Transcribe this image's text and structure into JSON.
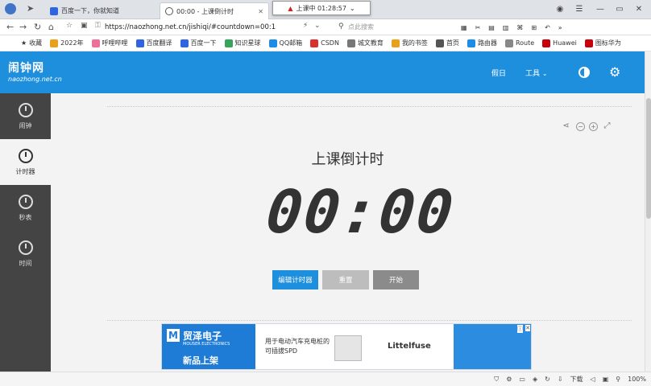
{
  "tabs": [
    {
      "label": "百度一下，你就知道"
    },
    {
      "label": "00:00 - 上课倒计时"
    }
  ],
  "clock_popup": {
    "text": "上课中 01:28:57"
  },
  "address": {
    "url": "https://naozhong.net.cn/jishiqi/#countdown=00:1",
    "search_placeholder": "点此搜索"
  },
  "toolbar_right": {
    "download": "下载",
    "zoom": "100%"
  },
  "bookmarks": [
    "收藏",
    "2022年",
    "呼哩哔哩",
    "百度翻译",
    "百度一下",
    "知识星球",
    "QQ邮箱",
    "CSDN",
    "城文教育",
    "我的书签",
    "首页",
    "路由器",
    "Route",
    "Huawei",
    "图标华为"
  ],
  "header": {
    "logo": "闹钟网",
    "domain": "naozhong.net.cn",
    "holiday": "假日",
    "tools": "工具"
  },
  "sidebar": [
    {
      "label": "闹钟"
    },
    {
      "label": "计时器"
    },
    {
      "label": "秒表"
    },
    {
      "label": "时间"
    }
  ],
  "timer": {
    "title": "上课倒计时",
    "time": "00:00"
  },
  "buttons": {
    "edit": "编辑计时器",
    "reset": "重置",
    "start": "开始"
  },
  "ad": {
    "brand": "贸泽电子",
    "brand_en": "MOUSER ELECTRONICS",
    "new_product": "新品上架",
    "line1": "用于电动汽车充电桩的",
    "line2": "可插拔SPD",
    "partner": "Littelfuse"
  },
  "colors": {
    "header_blue": "#1e8fdc",
    "edit_button": "#1e8fdc",
    "reset_button": "#bdbdbd",
    "start_button": "#8b8b8b",
    "sidebar": "#444444"
  }
}
